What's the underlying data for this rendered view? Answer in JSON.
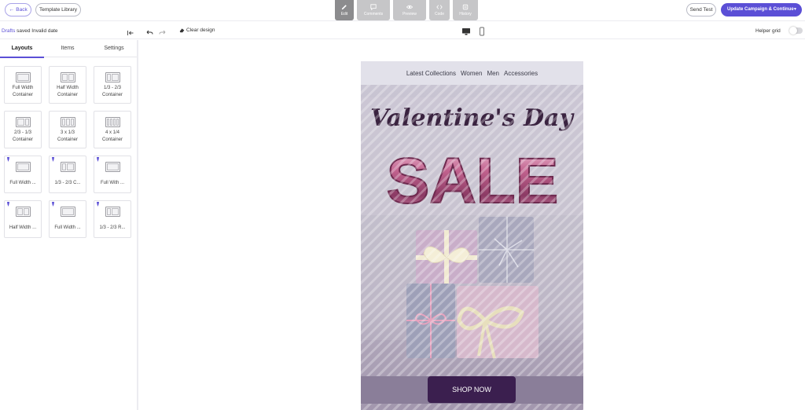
{
  "topbar": {
    "back_label": "Back",
    "template_library_label": "Template Library",
    "modes": [
      {
        "label": "Edit",
        "icon": "pencil-icon",
        "active": true
      },
      {
        "label": "Comments",
        "icon": "comment-icon",
        "active": false
      },
      {
        "label": "Preview",
        "icon": "eye-icon",
        "active": false
      },
      {
        "label": "Code",
        "icon": "code-icon",
        "active": false
      },
      {
        "label": "History",
        "icon": "history-icon",
        "active": false
      }
    ],
    "send_test_label": "Send Test",
    "update_label": "Update Campaign & Continue"
  },
  "toolbar": {
    "drafts_link": "Drafts",
    "saved_status": " saved Invalid date",
    "clear_design_label": "Clear design",
    "helper_grid_label": "Helper grid"
  },
  "sidebar": {
    "tabs": [
      "Layouts",
      "Items",
      "Settings"
    ],
    "active_tab": "Layouts",
    "layouts": [
      {
        "label": "Full Width Container",
        "pinned": false
      },
      {
        "label": "Half Width Container",
        "pinned": false
      },
      {
        "label": "1/3 - 2/3 Container",
        "pinned": false
      },
      {
        "label": "2/3 - 1/3 Container",
        "pinned": false
      },
      {
        "label": "3 x 1/3 Container",
        "pinned": false
      },
      {
        "label": "4 x 1/4 Container",
        "pinned": false
      },
      {
        "label": "Full Width ...",
        "pinned": true
      },
      {
        "label": "1/3 - 2/3 C...",
        "pinned": true
      },
      {
        "label": "Full With ...",
        "pinned": true
      },
      {
        "label": "Half Width ...",
        "pinned": true
      },
      {
        "label": "Full Width ...",
        "pinned": true
      },
      {
        "label": "1/3 - 2/3 R...",
        "pinned": true
      }
    ]
  },
  "email": {
    "nav": [
      "Latest Collections",
      "Women",
      "Men",
      "Accessories"
    ],
    "hero_script": "Valentine's Day",
    "hero_sale": "SALE",
    "cta_label": "SHOP NOW"
  },
  "colors": {
    "accent": "#5b4fd6",
    "cta_bg": "#3b1f4f",
    "email_bg": "#d4d1da"
  }
}
